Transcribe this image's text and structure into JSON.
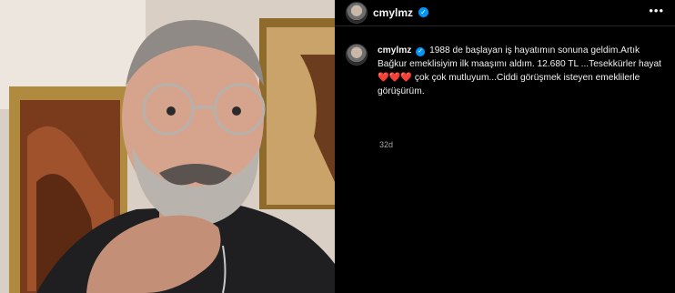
{
  "post": {
    "username": "cmylmz",
    "caption": {
      "part1": "1988 de başlayan iş hayatımın sonuna geldim.Artık Bağkur emeklisiyim ilk maaşımı aldım. 12.680 TL ...Tesekkürler hayat",
      "hearts": "❤️❤️❤️",
      "part2": "çok çok mutluyum...Ciddi görüşmek isteyen emeklilerle görüşürüm."
    },
    "timestamp": "32d"
  },
  "icons": {
    "verified": "verified-badge-icon",
    "more": "more-options-icon"
  },
  "colors": {
    "background": "#000000",
    "verified": "#0095f6",
    "text": "#f5f5f5",
    "muted": "#a8a8a8"
  }
}
